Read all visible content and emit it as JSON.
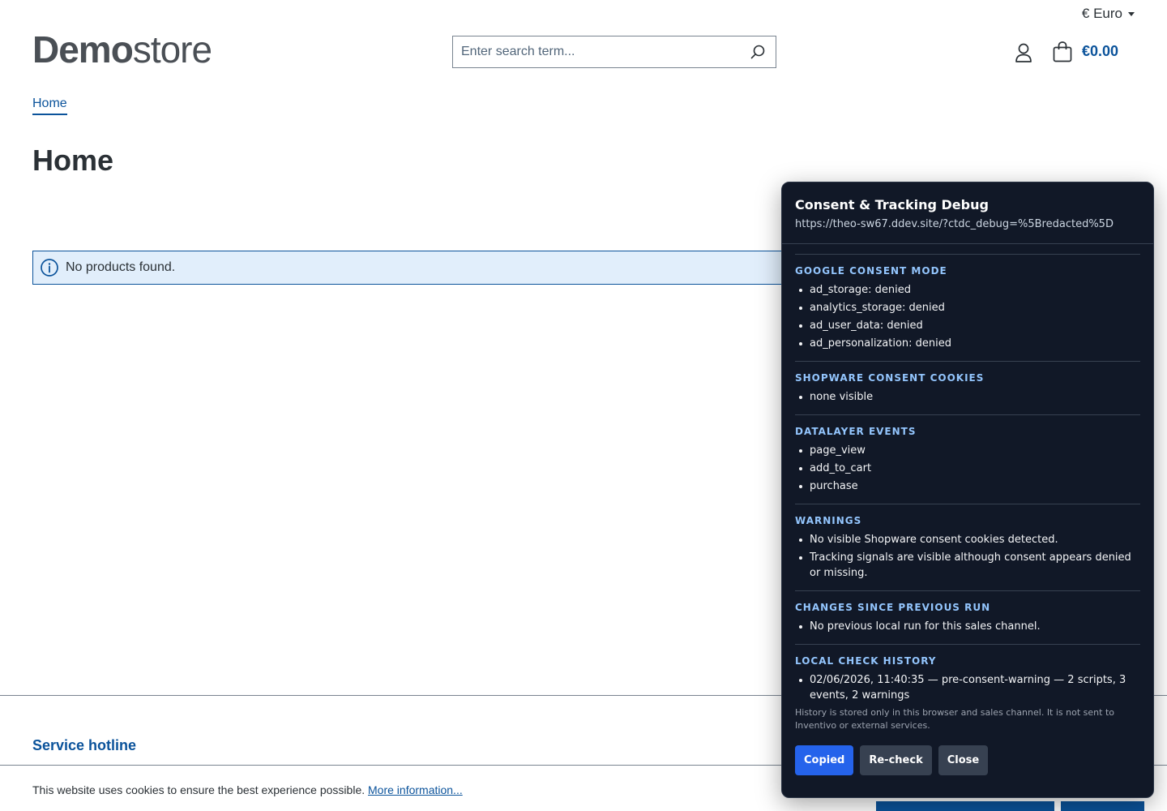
{
  "header": {
    "currency_label": "€ Euro",
    "logo_bold": "Demo",
    "logo_light": "store",
    "search_placeholder": "Enter search term...",
    "cart_amount": "€0.00"
  },
  "breadcrumb": {
    "home": "Home"
  },
  "page_title": "Home",
  "alert": {
    "message": "No products found."
  },
  "footer": {
    "hotline_title": "Service hotline"
  },
  "cookie_bar": {
    "text": "This website uses cookies to ensure the best experience possible.",
    "link": "More information..."
  },
  "debug_panel": {
    "title": "Consent & Tracking Debug",
    "url": "https://theo-sw67.ddev.site/?ctdc_debug=%5Bredacted%5D",
    "sections": [
      {
        "title": "Google Consent Mode",
        "items": [
          "ad_storage: denied",
          "analytics_storage: denied",
          "ad_user_data: denied",
          "ad_personalization: denied"
        ]
      },
      {
        "title": "Shopware Consent Cookies",
        "items": [
          "none visible"
        ]
      },
      {
        "title": "DataLayer Events",
        "items": [
          "page_view",
          "add_to_cart",
          "purchase"
        ]
      },
      {
        "title": "Warnings",
        "items": [
          "No visible Shopware consent cookies detected.",
          "Tracking signals are visible although consent appears denied or missing."
        ]
      },
      {
        "title": "Changes since previous run",
        "items": [
          "No previous local run for this sales channel."
        ]
      },
      {
        "title": "Local check history",
        "items": [
          "02/06/2026, 11:40:35 — pre-consent-warning — 2 scripts, 3 events, 2 warnings"
        ]
      }
    ],
    "note": "History is stored only in this browser and sales channel. It is not sent to Inventivo or external services.",
    "buttons": {
      "copied": "Copied",
      "recheck": "Re-check",
      "close": "Close"
    }
  },
  "colors": {
    "brand_blue": "#0b539b",
    "alert_bg": "#e1eefb",
    "panel_bg": "#111827",
    "panel_accent": "#93c5fd",
    "primary_button": "#2563eb"
  }
}
